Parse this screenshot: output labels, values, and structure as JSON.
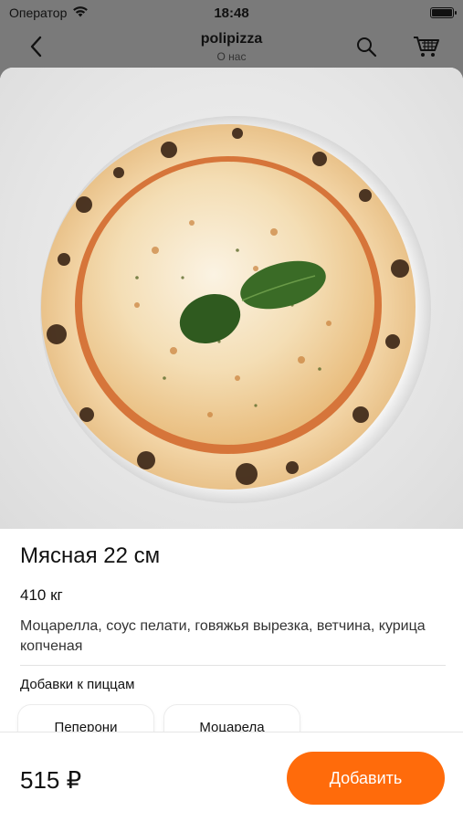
{
  "status_bar": {
    "carrier": "Оператор",
    "time": "18:48"
  },
  "nav": {
    "title": "polipizza",
    "subtitle": "О нас"
  },
  "product": {
    "name": "Мясная 22 см",
    "weight": "410 кг",
    "description": "Моцарелла, соус пелати, говяжья вырезка, ветчина, курица копченая"
  },
  "addons": {
    "title": "Добавки к пиццам",
    "items": [
      {
        "label": "Пеперони"
      },
      {
        "label": "Моцарела"
      }
    ]
  },
  "checkout": {
    "price": "515 ₽",
    "add_label": "Добавить"
  },
  "colors": {
    "accent": "#ff6b0b",
    "overlay": "#7a7a7a"
  }
}
